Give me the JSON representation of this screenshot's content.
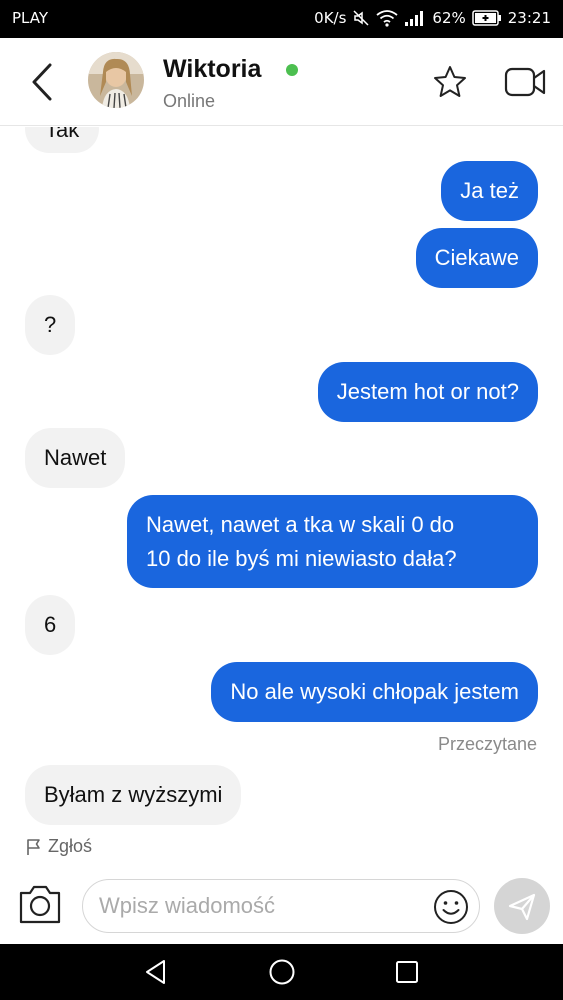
{
  "status_bar": {
    "carrier": "PLAY",
    "network_speed": "0K/s",
    "battery_percent": "62%",
    "time": "23:21"
  },
  "header": {
    "contact_name": "Wiktoria",
    "contact_status": "Online",
    "online_indicator_color": "#4cbf50"
  },
  "messages": [
    {
      "direction": "in",
      "text": "Tak"
    },
    {
      "direction": "out",
      "text": "Ja też"
    },
    {
      "direction": "out",
      "text": "Ciekawe"
    },
    {
      "direction": "in",
      "text": "?"
    },
    {
      "direction": "out",
      "text": "Jestem hot or not?"
    },
    {
      "direction": "in",
      "text": "Nawet"
    },
    {
      "direction": "out",
      "lines": [
        "Nawet, nawet a tka w skali 0 do",
        "10 do ile byś mi niewiasto dała?"
      ]
    },
    {
      "direction": "in",
      "text": "6"
    },
    {
      "direction": "out",
      "text": "No ale wysoki chłopak jestem"
    },
    {
      "direction": "in",
      "text": "Byłam z wyższymi"
    }
  ],
  "read_receipt": "Przeczytane",
  "report_label": "Zgłoś",
  "composer": {
    "placeholder": "Wpisz wiadomość"
  },
  "colors": {
    "outgoing_bubble": "#1a66de",
    "incoming_bubble": "#f2f2f2",
    "send_button": "#d5d5d5"
  }
}
